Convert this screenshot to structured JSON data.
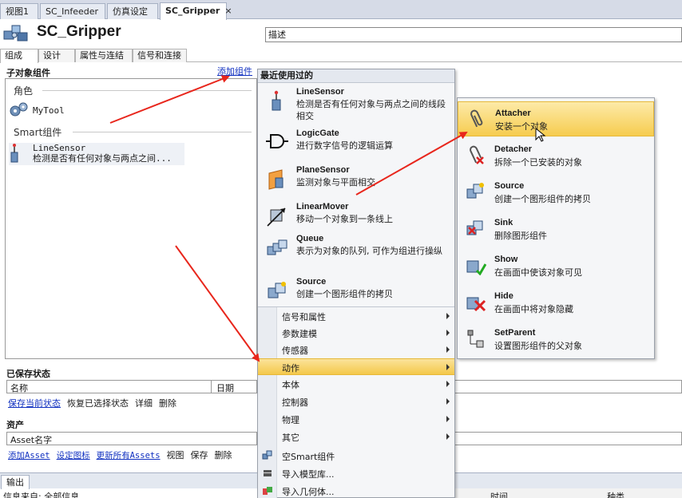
{
  "doc_tabs": [
    {
      "label": "视图1"
    },
    {
      "label": "SC_Infeeder"
    },
    {
      "label": "仿真设定"
    },
    {
      "label": "SC_Gripper",
      "close": "×"
    }
  ],
  "header": {
    "title": "SC_Gripper",
    "description_placeholder": "描述"
  },
  "prop_tabs": [
    "组成",
    "设计",
    "属性与连结",
    "信号和连接"
  ],
  "children": {
    "section_title": "子对象组件",
    "add_link": "添加组件",
    "groups": [
      {
        "label": "角色",
        "items": [
          {
            "name": "MyTool"
          }
        ]
      },
      {
        "label": "Smart组件",
        "items": [
          {
            "name": "LineSensor",
            "desc": "检测是否有任何对象与两点之间..."
          }
        ]
      }
    ]
  },
  "saved_state": {
    "section_title": "已保存状态",
    "columns": [
      "名称",
      "日期"
    ],
    "actions": [
      {
        "label": "保存当前状态",
        "link": true
      },
      {
        "label": "恢复已选择状态",
        "link": false
      },
      {
        "label": "详细",
        "link": false
      },
      {
        "label": "删除",
        "link": false
      }
    ]
  },
  "assets": {
    "section_title": "资产",
    "column": "Asset名字",
    "actions": [
      {
        "label": "添加Asset",
        "link": true
      },
      {
        "label": "设定图标",
        "link": true
      },
      {
        "label": "更新所有Assets",
        "link": true
      },
      {
        "label": "视图",
        "link": false
      },
      {
        "label": "保存",
        "link": false
      },
      {
        "label": "删除",
        "link": false
      }
    ]
  },
  "output": {
    "tab": "输出",
    "row_source": "信息来自: 全部信息",
    "col_time": "时间",
    "col_category": "种类"
  },
  "menu": {
    "header": "最近使用过的",
    "recent": [
      {
        "name": "LineSensor",
        "desc": "检测是否有任何对象与两点之间的线段相交"
      },
      {
        "name": "LogicGate",
        "desc": "进行数字信号的逻辑运算"
      },
      {
        "name": "PlaneSensor",
        "desc": "监测对象与平面相交"
      },
      {
        "name": "LinearMover",
        "desc": "移动一个对象到一条线上"
      },
      {
        "name": "Queue",
        "desc": "表示为对象的队列, 可作为组进行操纵"
      },
      {
        "name": "Source",
        "desc": "创建一个图形组件的拷贝"
      }
    ],
    "categories": [
      {
        "label": "信号和属性"
      },
      {
        "label": "参数建模"
      },
      {
        "label": "传感器"
      },
      {
        "label": "动作",
        "highlighted": true
      },
      {
        "label": "本体"
      },
      {
        "label": "控制器"
      },
      {
        "label": "物理"
      },
      {
        "label": "其它"
      }
    ],
    "commands": [
      {
        "label": "空Smart组件"
      },
      {
        "label": "导入模型库..."
      },
      {
        "label": "导入几何体..."
      }
    ]
  },
  "submenu": {
    "items": [
      {
        "name": "Attacher",
        "desc": "安装一个对象",
        "highlighted": true
      },
      {
        "name": "Detacher",
        "desc": "拆除一个已安装的对象"
      },
      {
        "name": "Source",
        "desc": "创建一个图形组件的拷贝"
      },
      {
        "name": "Sink",
        "desc": "删除图形组件"
      },
      {
        "name": "Show",
        "desc": "在画面中使该对象可见"
      },
      {
        "name": "Hide",
        "desc": "在画面中将对象隐藏"
      },
      {
        "name": "SetParent",
        "desc": "设置图形组件的父对象"
      }
    ]
  },
  "colors": {
    "highlight": "#f4c84b",
    "link": "#1030c0",
    "annotation_arrow": "#e8261c"
  }
}
